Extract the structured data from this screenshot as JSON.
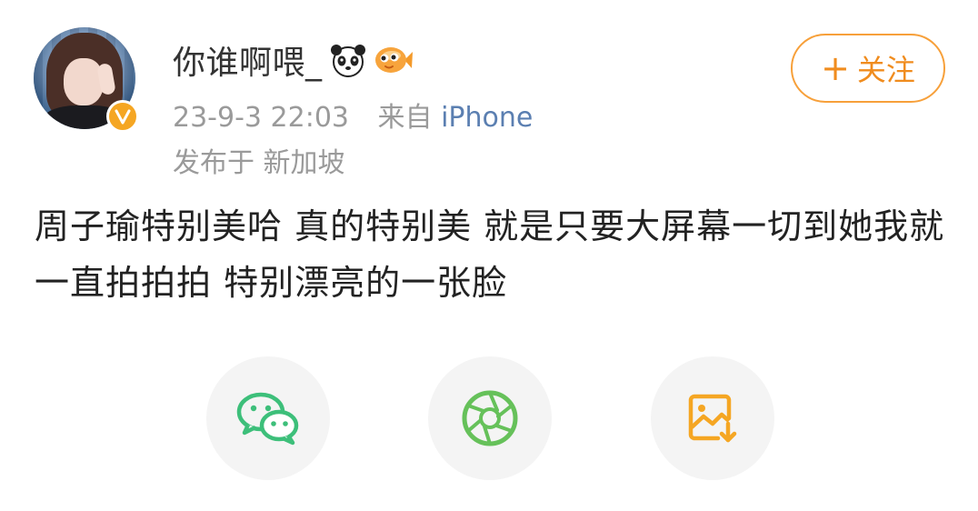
{
  "post": {
    "username": "你谁啊喂_",
    "timestamp": "23-9-3 22:03",
    "source_prefix": "来自",
    "source": "iPhone",
    "location": "发布于 新加坡",
    "follow_label": "关注",
    "follow_plus": "+",
    "text": "周子瑜特别美哈 真的特别美 就是只要大屏幕一切到她我就一直拍拍拍 特别漂亮的一张脸",
    "emojis": [
      "panda-icon",
      "fish-icon"
    ]
  },
  "share_actions": [
    {
      "name": "wechat",
      "icon": "wechat-icon"
    },
    {
      "name": "moments",
      "icon": "moments-icon"
    },
    {
      "name": "save-image",
      "icon": "save-image-icon"
    }
  ],
  "colors": {
    "accent": "#f08c1e",
    "link": "#5b7fb1",
    "meta": "#9a9a9a",
    "wechat": "#3dbf7a",
    "moments": "#66c15a",
    "save": "#f5a623"
  }
}
